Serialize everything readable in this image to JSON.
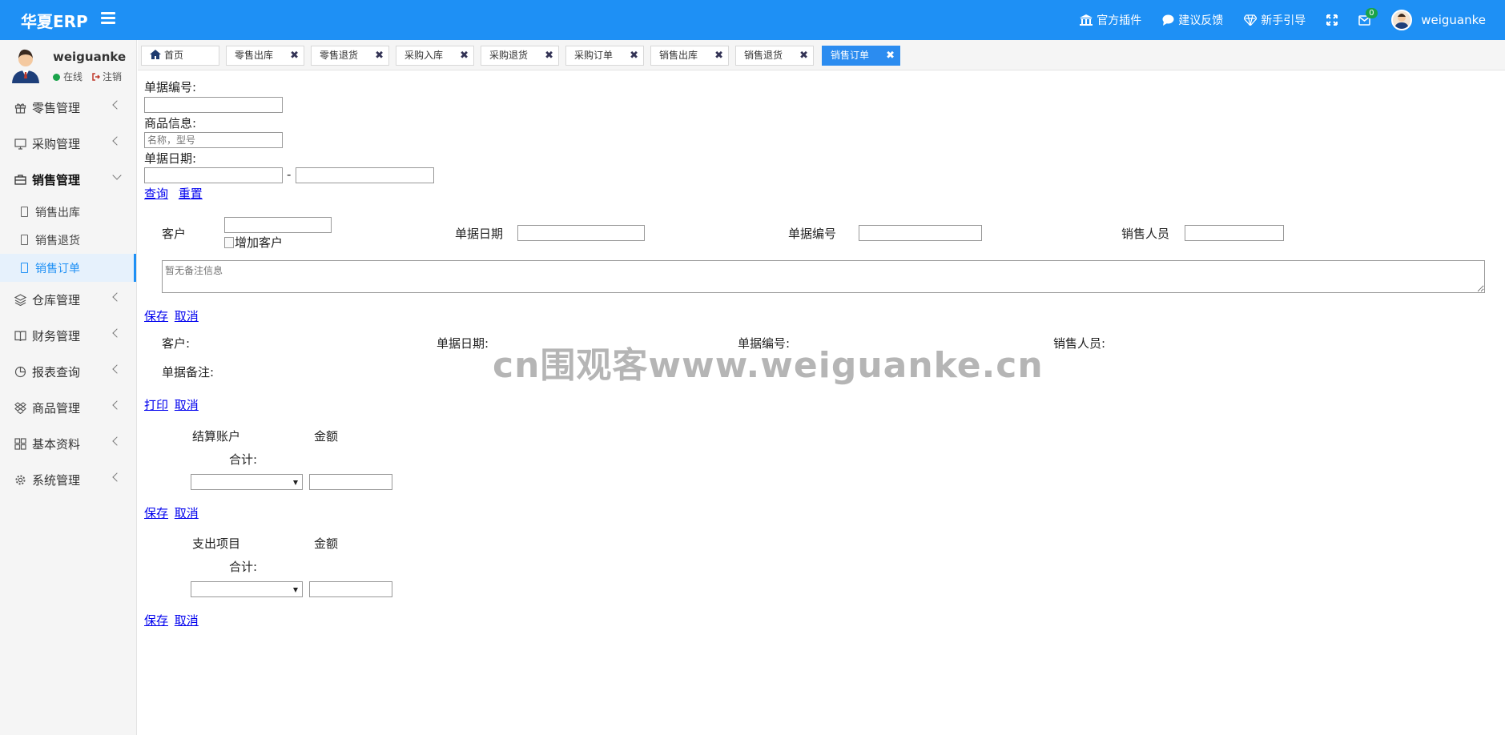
{
  "header": {
    "brand": "华夏ERP",
    "nav": [
      {
        "label": "官方插件",
        "icon": "bank-icon"
      },
      {
        "label": "建议反馈",
        "icon": "chat-icon"
      },
      {
        "label": "新手引导",
        "icon": "diamond-icon"
      }
    ],
    "mail_count": "0",
    "username": "weiguanke"
  },
  "sidebar": {
    "profile": {
      "name": "weiguanke",
      "status": "在线",
      "logout": "注销"
    },
    "menu": [
      {
        "label": "零售管理",
        "icon": "gift-icon"
      },
      {
        "label": "采购管理",
        "icon": "monitor-icon"
      },
      {
        "label": "销售管理",
        "icon": "briefcase-icon"
      },
      {
        "label": "仓库管理",
        "icon": "layers-icon"
      },
      {
        "label": "财务管理",
        "icon": "book-icon"
      },
      {
        "label": "报表查询",
        "icon": "pie-icon"
      },
      {
        "label": "商品管理",
        "icon": "dropbox-icon"
      },
      {
        "label": "基本资料",
        "icon": "grid-icon"
      },
      {
        "label": "系统管理",
        "icon": "gear-icon"
      }
    ],
    "sales_sub": [
      "销售出库",
      "销售退货",
      "销售订单"
    ]
  },
  "tabs": [
    "首页",
    "零售出库",
    "零售退货",
    "采购入库",
    "采购退货",
    "采购订单",
    "销售出库",
    "销售退货",
    "销售订单"
  ],
  "search": {
    "bill_no_label": "单据编号:",
    "goods_label": "商品信息:",
    "goods_placeholder": "名称，型号",
    "date_label": "单据日期:",
    "date_sep": "-",
    "query": "查询",
    "reset": "重置"
  },
  "edit_form": {
    "customer_label": "客户",
    "add_customer_alt": "增加客户",
    "date_label": "单据日期",
    "bill_no_label": "单据编号",
    "salesman_label": "销售人员",
    "memo_placeholder": "暂无备注信息",
    "save": "保存",
    "cancel": "取消"
  },
  "detail": {
    "customer_label": "客户:",
    "date_label": "单据日期:",
    "bill_no_label": "单据编号:",
    "salesman_label": "销售人员:",
    "memo_label": "单据备注:",
    "print": "打印",
    "cancel": "取消"
  },
  "account_table": {
    "col1": "结算账户",
    "col2": "金额",
    "total": "合计:",
    "save": "保存",
    "cancel": "取消"
  },
  "expense_table": {
    "col1": "支出项目",
    "col2": "金额",
    "total": "合计:",
    "save": "保存",
    "cancel": "取消"
  },
  "watermark": "cn围观客www.weiguanke.cn"
}
